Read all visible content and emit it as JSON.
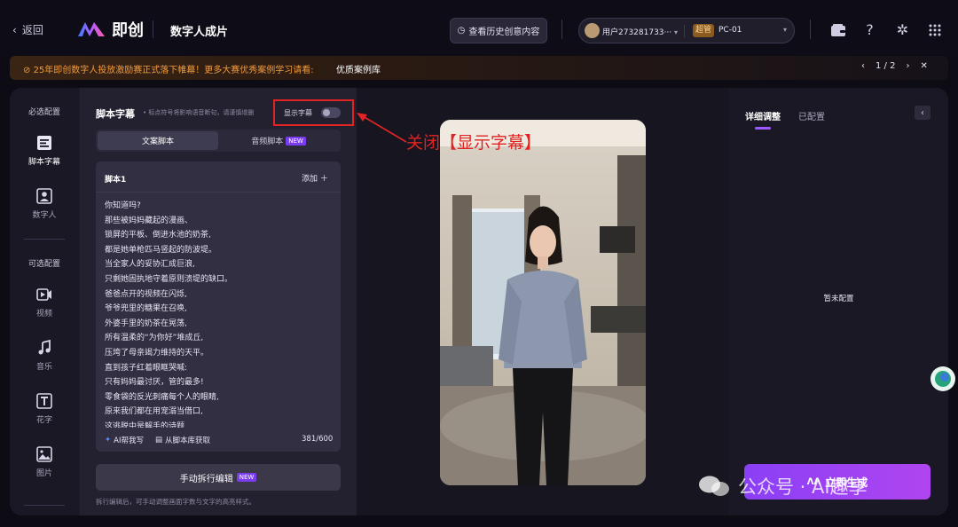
{
  "header": {
    "back_label": "返回",
    "logo_text": "即创",
    "page_title": "数字人成片",
    "history_button": "查看历史创意内容",
    "user_name": "用户273281733···",
    "role_badge": "超管",
    "device_name": "PC-01"
  },
  "notice": {
    "text": "25年即创数字人投放激励赛正式落下帷幕！更多大赛优秀案例学习请看:",
    "link": "优质案例库",
    "page": "1 / 2"
  },
  "left_nav": {
    "required_header": "必选配置",
    "optional_header": "可选配置",
    "items": [
      {
        "label": "脚本字幕",
        "icon": "script-subtitle-icon"
      },
      {
        "label": "数字人",
        "icon": "digital-human-icon"
      },
      {
        "label": "视频",
        "icon": "video-icon"
      },
      {
        "label": "音乐",
        "icon": "music-icon"
      },
      {
        "label": "花字",
        "icon": "text-effect-icon"
      },
      {
        "label": "图片",
        "icon": "image-icon"
      }
    ]
  },
  "script_panel": {
    "title": "脚本字幕",
    "hint": "• 标点符号将影响语音断句，请谨慎增删",
    "toggle_label": "显示字幕",
    "toggle_on": false,
    "tabs": [
      {
        "label": "文案脚本",
        "active": true
      },
      {
        "label": "音频脚本",
        "active": false,
        "badge": "NEW"
      }
    ],
    "card_title": "脚本1",
    "add_label": "添加",
    "lines": [
      "你知道吗?",
      "那些被妈妈藏起的漫画、",
      "锁屏的平板、倒进水池的奶茶,",
      "都是她单枪匹马竖起的防波堤。",
      "当全家人的妥协汇成巨浪,",
      "只剩她固执地守着原则溃堤的缺口。",
      "爸爸点开的视频在闪烁,",
      "爷爷兜里的糖果在召唤,",
      "外婆手里的奶茶在晃荡,",
      "所有温柔的“为你好”堆成丘,",
      "压垮了母亲竭力维持的天平。",
      "直到孩子红着眼眶哭喊:",
      "只有妈妈最讨厌，管的最多!",
      "零食袋的反光刺痛每个人的眼睛,",
      "原来我们都在用宠溺当借口,",
      "这逃脱中是解手的诗题"
    ],
    "ai_write": "AI帮我写",
    "from_library": "从脚本库获取",
    "char_count": "381/600",
    "split_button": "手动拆行编辑",
    "split_badge": "NEW",
    "split_hint": "拆行编辑后，可手动调整画面字数与文字的高亮样式。"
  },
  "right_panel": {
    "tabs": [
      "详细调整",
      "已配置"
    ],
    "empty_text": "暂未配置",
    "generate_button": "立即生成"
  },
  "annotation": {
    "text": "关闭【显示字幕】"
  },
  "watermark": {
    "text": "公众号 · AI趣享"
  },
  "colors": {
    "accent": "#9b59ff",
    "notice": "#f29a3a",
    "annotation": "#e02424"
  }
}
